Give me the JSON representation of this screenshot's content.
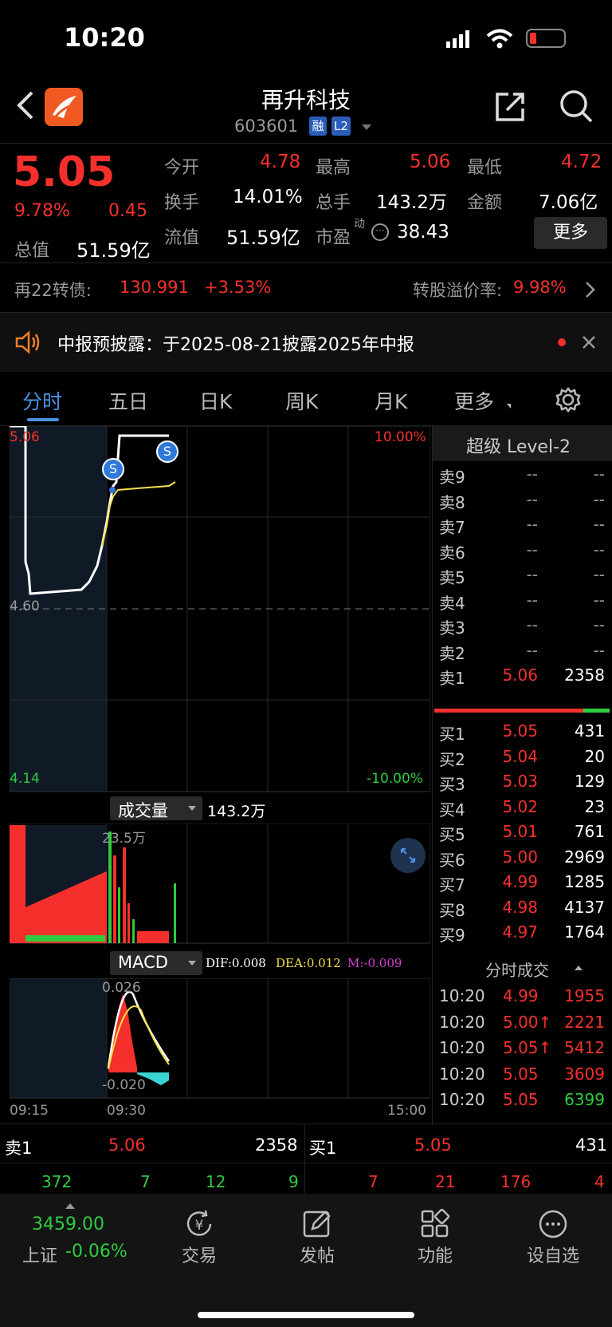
{
  "status": {
    "time": "10:20"
  },
  "header": {
    "name": "再升科技",
    "code": "603601",
    "tag1": "融",
    "tag2": "L2"
  },
  "quote": {
    "price": "5.05",
    "pct": "9.78%",
    "chg": "0.45",
    "open_l": "今开",
    "open": "4.78",
    "high_l": "最高",
    "high": "5.06",
    "low_l": "最低",
    "low": "4.72",
    "turn_l": "换手",
    "turn": "14.01%",
    "vol_l": "总手",
    "vol": "143.2万",
    "amt_l": "金额",
    "amt": "7.06亿",
    "mcap_l": "总值",
    "mcap": "51.59亿",
    "fcap_l": "流值",
    "fcap": "51.59亿",
    "pe_l": "市盈",
    "pe_sup": "动",
    "pe": "38.43",
    "more": "更多"
  },
  "bond": {
    "label": "再22转债:",
    "price": "130.991",
    "pct": "+3.53%",
    "prem": "转股溢价率:",
    "prem_v": "9.98%"
  },
  "notice": {
    "text": "中报预披露：于2025-08-21披露2025年中报"
  },
  "tabs": [
    "分时",
    "五日",
    "日K",
    "周K",
    "月K",
    "更多"
  ],
  "chart": {
    "top_price": "5.06",
    "top_pct": "10.00%",
    "mid_price": "4.60",
    "bot_price": "4.14",
    "bot_pct": "-10.00%",
    "vol_btn": "成交量",
    "vol_total": "143.2万",
    "vol_max": "23.5万",
    "macd_btn": "MACD",
    "dif": "DIF:0.008",
    "dea": "DEA:0.012",
    "m": "M:-0.009",
    "macd_hi": "0.026",
    "macd_lo": "-0.020",
    "t1": "09:15",
    "t2": "09:30",
    "t3": "15:00",
    "marker": "S"
  },
  "orderbook": {
    "title": "超级 Level-2",
    "asks": [
      {
        "l": "卖9",
        "p": "--",
        "v": "--"
      },
      {
        "l": "卖8",
        "p": "--",
        "v": "--"
      },
      {
        "l": "卖7",
        "p": "--",
        "v": "--"
      },
      {
        "l": "卖6",
        "p": "--",
        "v": "--"
      },
      {
        "l": "卖5",
        "p": "--",
        "v": "--"
      },
      {
        "l": "卖4",
        "p": "--",
        "v": "--"
      },
      {
        "l": "卖3",
        "p": "--",
        "v": "--"
      },
      {
        "l": "卖2",
        "p": "--",
        "v": "--"
      },
      {
        "l": "卖1",
        "p": "5.06",
        "v": "2358"
      }
    ],
    "bids": [
      {
        "l": "买1",
        "p": "5.05",
        "v": "431"
      },
      {
        "l": "买2",
        "p": "5.04",
        "v": "20"
      },
      {
        "l": "买3",
        "p": "5.03",
        "v": "129"
      },
      {
        "l": "买4",
        "p": "5.02",
        "v": "23"
      },
      {
        "l": "买5",
        "p": "5.01",
        "v": "761"
      },
      {
        "l": "买6",
        "p": "5.00",
        "v": "2969"
      },
      {
        "l": "买7",
        "p": "4.99",
        "v": "1285"
      },
      {
        "l": "买8",
        "p": "4.98",
        "v": "4137"
      },
      {
        "l": "买9",
        "p": "4.97",
        "v": "1764"
      }
    ],
    "ticks_title": "分时成交",
    "ticks": [
      {
        "t": "10:20",
        "p": "4.99",
        "v": "1955"
      },
      {
        "t": "10:20",
        "p": "5.00↑",
        "v": "2221"
      },
      {
        "t": "10:20",
        "p": "5.05↑",
        "v": "5412"
      },
      {
        "t": "10:20",
        "p": "5.05",
        "v": "3609"
      },
      {
        "t": "10:20",
        "p": "5.05",
        "v": "6399"
      }
    ]
  },
  "bar": {
    "s_l": "卖1",
    "s_p": "5.06",
    "s_v": "2358",
    "b_l": "买1",
    "b_p": "5.05",
    "b_v": "431",
    "n1": "372",
    "n2": "7",
    "n3": "12",
    "n4": "9",
    "n5": "7",
    "n6": "21",
    "n7": "176",
    "n8": "4"
  },
  "nav": {
    "index": "3459.00",
    "idx_name": "上证",
    "idx_pct": "-0.06%",
    "trade": "交易",
    "post": "发帖",
    "func": "功能",
    "watch": "设自选"
  }
}
